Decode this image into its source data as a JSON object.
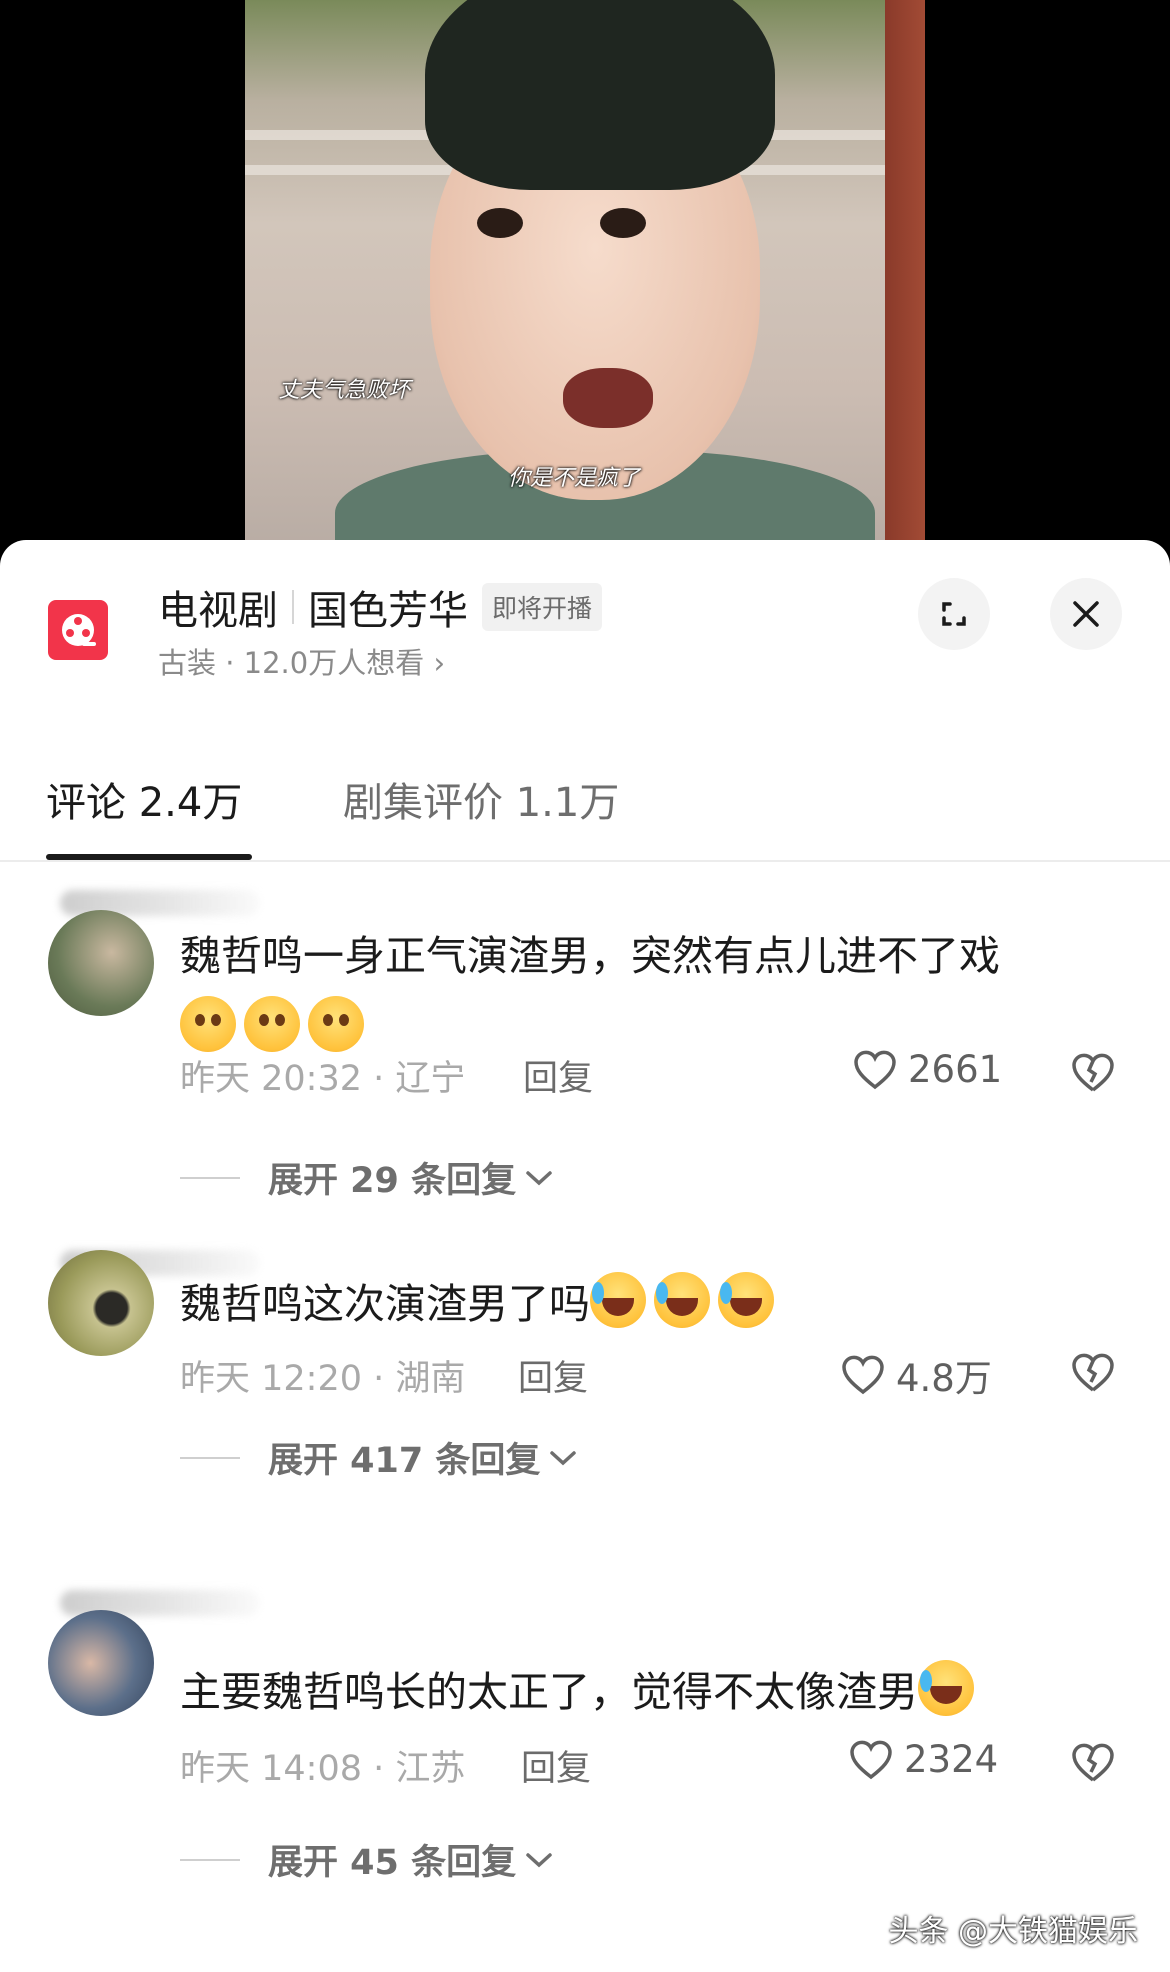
{
  "video": {
    "subtitle_top": "丈夫气急败坏",
    "subtitle_bottom": "你是不是疯了"
  },
  "show": {
    "category": "电视剧",
    "title": "国色芳华",
    "badge": "即将开播",
    "meta": "古装 · 12.0万人想看 ›",
    "expand_icon": "expand-icon",
    "close_icon": "close-icon"
  },
  "tabs": [
    {
      "label": "评论 2.4万",
      "active": true
    },
    {
      "label": "剧集评价 1.1万",
      "active": false
    }
  ],
  "comments": [
    {
      "text": "魏哲鸣一身正气演渣男，突然有点儿进不了戏",
      "emoji": "smirk-emoji",
      "emoji_count": 3,
      "time_location": "昨天 20:32 · 辽宁",
      "reply_label": "回复",
      "likes": "2661",
      "expand_label": "展开 29 条回复"
    },
    {
      "text": "魏哲鸣这次演渣男了吗",
      "emoji": "rofl-emoji",
      "emoji_count": 3,
      "time_location": "昨天 12:20 · 湖南",
      "reply_label": "回复",
      "likes": "4.8万",
      "expand_label": "展开 417 条回复"
    },
    {
      "text": "主要魏哲鸣长的太正了，觉得不太像渣男",
      "emoji": "rofl-emoji",
      "emoji_count": 1,
      "time_location": "昨天 14:08 · 江苏",
      "reply_label": "回复",
      "likes": "2324",
      "expand_label": "展开 45 条回复"
    }
  ],
  "watermark": "头条 @大铁猫娱乐",
  "colors": {
    "brand_red": "#f2344a",
    "text_primary": "#1b1b1b",
    "text_secondary": "#a9a9a9"
  }
}
